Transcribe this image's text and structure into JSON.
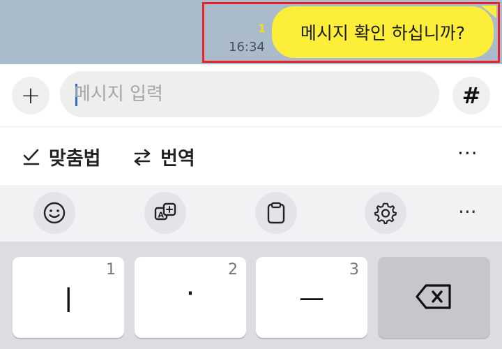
{
  "chat": {
    "message": "메시지 확인 하십니까?",
    "unread_count": "1",
    "time": "16:34",
    "bubble_color": "#fdee39"
  },
  "input_bar": {
    "placeholder": "메시지 입력",
    "plus_symbol": "+",
    "hash_symbol": "#"
  },
  "suggestions": {
    "spellcheck_label": "맞춤법",
    "translate_label": "번역",
    "more_label": "···"
  },
  "toolbar": {
    "icons": [
      "smiley-icon",
      "translate-icon",
      "clipboard-icon",
      "gear-icon"
    ],
    "more_label": "···"
  },
  "keyboard": {
    "keys": [
      {
        "glyph": "ㅣ",
        "number": "1"
      },
      {
        "glyph": "·",
        "number": "2"
      },
      {
        "glyph": "ㅡ",
        "number": "3"
      }
    ],
    "delete_icon": "backspace-icon"
  }
}
